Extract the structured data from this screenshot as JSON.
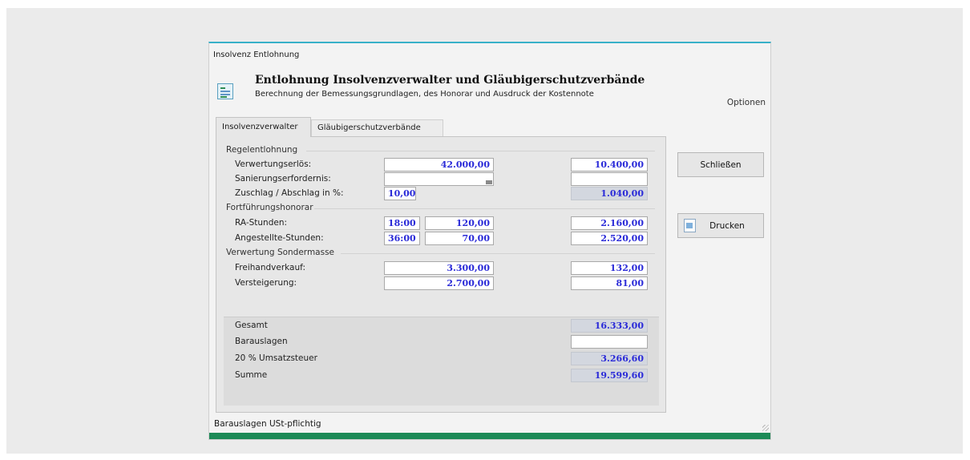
{
  "window": {
    "title": "Insolvenz Entlohnung"
  },
  "header": {
    "title": "Entlohnung Insolvenzverwalter und Gläubigerschutzverbände",
    "subtitle": "Berechnung der Bemessungsgrundlagen, des Honorar und Ausdruck der Kostennote",
    "options_label": "Optionen"
  },
  "tabs": [
    {
      "label": "Insolvenzverwalter",
      "active": true
    },
    {
      "label": "Gläubigerschutzverbände",
      "active": false
    }
  ],
  "sections": {
    "regelentlohnung": "Regelentlohnung",
    "fortfuehrung": "Fortführungshonorar",
    "sondermasse": "Verwertung Sondermasse"
  },
  "rows": {
    "verwertung": {
      "label": "Verwertungserlös:",
      "input": "42.000,00",
      "result": "10.400,00"
    },
    "sanierung": {
      "label": "Sanierungserfordernis:",
      "input": "",
      "result": ""
    },
    "zuschlag": {
      "label": "Zuschlag / Abschlag in %:",
      "input": "10,00",
      "result": "1.040,00"
    },
    "ra": {
      "label": "RA-Stunden:",
      "hours": "18:00",
      "rate": "120,00",
      "result": "2.160,00"
    },
    "angestellte": {
      "label": "Angestellte-Stunden:",
      "hours": "36:00",
      "rate": "70,00",
      "result": "2.520,00"
    },
    "freihand": {
      "label": "Freihandverkauf:",
      "input": "3.300,00",
      "result": "132,00"
    },
    "versteigerung": {
      "label": "Versteigerung:",
      "input": "2.700,00",
      "result": "81,00"
    }
  },
  "totals": {
    "gesamt": {
      "label": "Gesamt",
      "value": "16.333,00"
    },
    "barauslagen": {
      "label": "Barauslagen",
      "value": ""
    },
    "ust": {
      "label": "20 % Umsatzsteuer",
      "value": "3.266,60"
    },
    "summe": {
      "label": "Summe",
      "value": "19.599,60"
    }
  },
  "buttons": {
    "close": "Schließen",
    "print": "Drucken"
  },
  "status": "Barauslagen USt-pflichtig"
}
